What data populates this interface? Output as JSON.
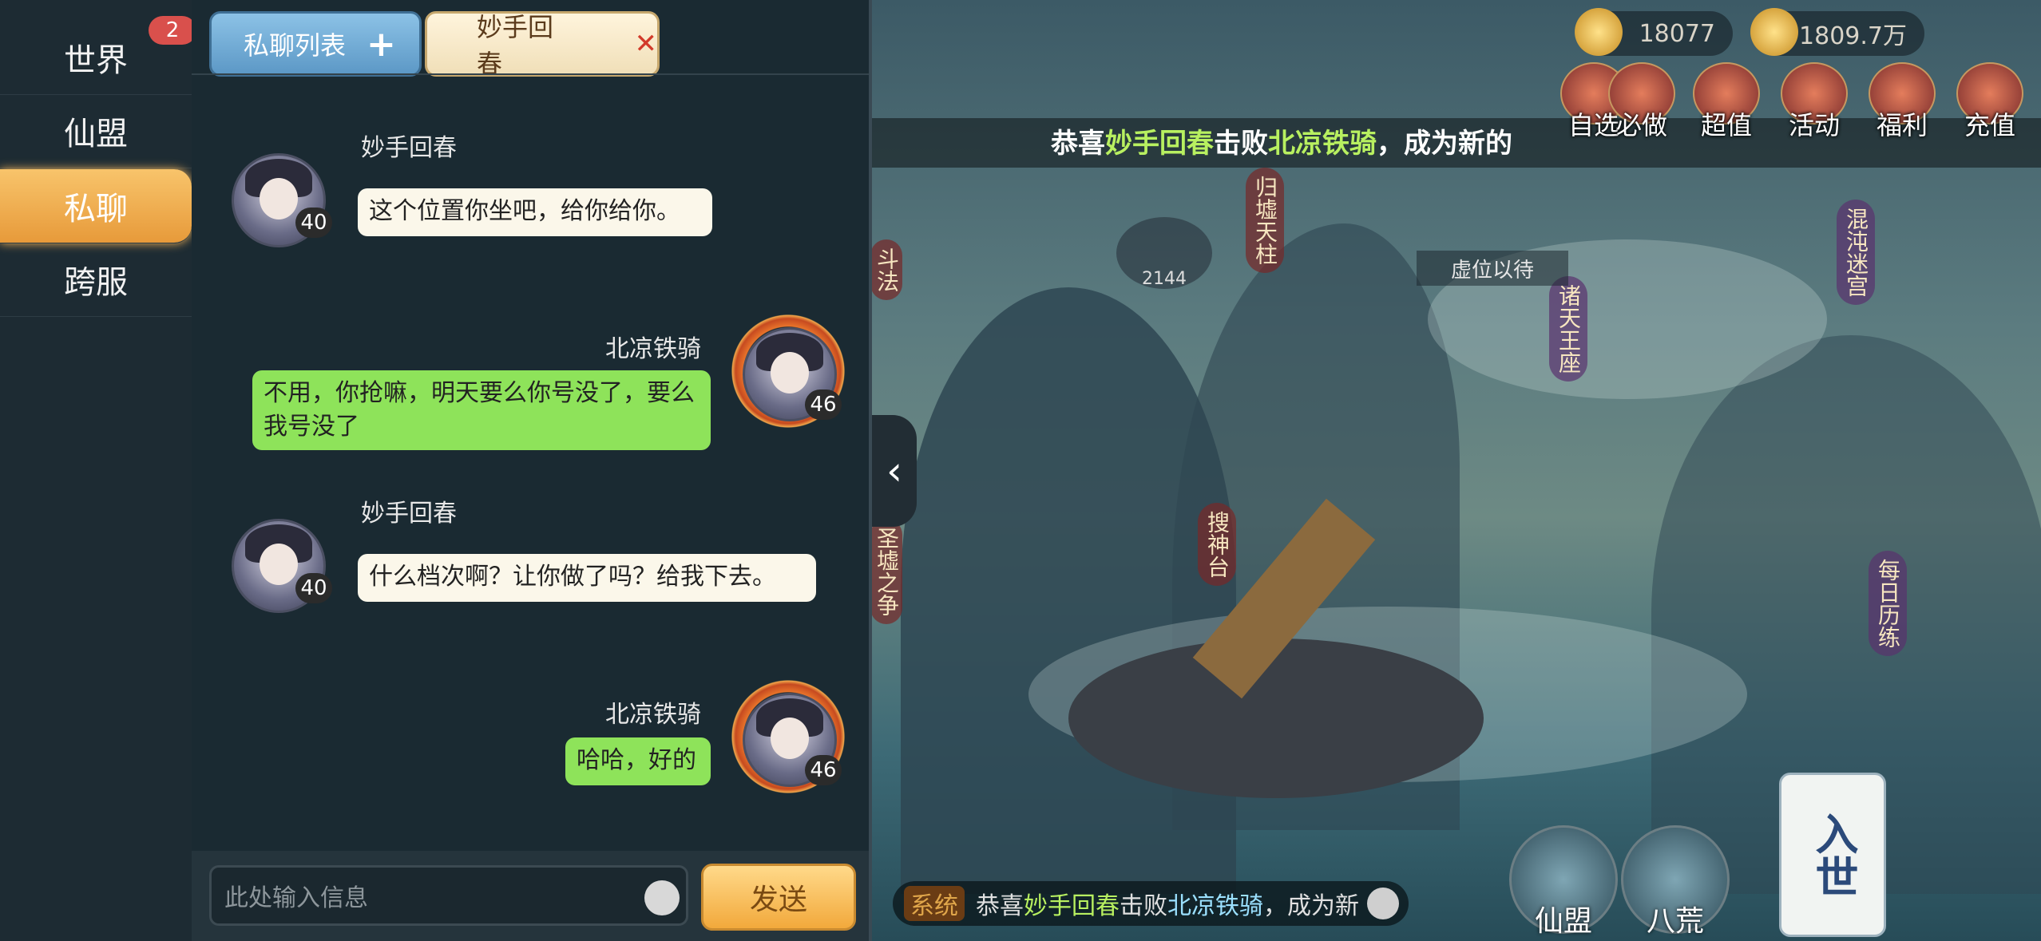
{
  "sidenav": {
    "items": [
      {
        "label": "世界"
      },
      {
        "label": "仙盟"
      },
      {
        "label": "私聊"
      },
      {
        "label": "跨服"
      }
    ],
    "world_badge": "2"
  },
  "tabs": {
    "list_label": "私聊列表",
    "list_add": "+",
    "active_label": "妙手回春",
    "active_close": "✕"
  },
  "messages": [
    {
      "sender": "妙手回春",
      "side": "left",
      "level": "40",
      "text": "这个位置你坐吧，给你给你。"
    },
    {
      "sender": "北凉铁骑",
      "side": "right",
      "level": "46",
      "text": "不用，你抢嘛，明天要么你号没了，要么我号没了"
    },
    {
      "sender": "妙手回春",
      "side": "left",
      "level": "40",
      "text": "什么档次啊？让你做了吗？给我下去。"
    },
    {
      "sender": "北凉铁骑",
      "side": "right",
      "level": "46",
      "text": "哈哈，好的"
    }
  ],
  "input": {
    "placeholder": "此处输入信息",
    "send_label": "发送"
  },
  "resources": {
    "currency1": "18077",
    "currency2": "1809.7万"
  },
  "top_icons": [
    "超值",
    "活动",
    "福利",
    "充值"
  ],
  "top_icons_partial": {
    "a": "自选",
    "b": "必做"
  },
  "marquee": {
    "prefix": "恭喜",
    "name1": "妙手回春",
    "mid": "击败",
    "name2": "北凉铁骑",
    "suffix": "，成为新的"
  },
  "scene_tags": {
    "guixu": "归墟天柱",
    "zhutian": "诸天王座",
    "hundun": "混沌迷宫",
    "soushen": "搜神台",
    "meiri": "每日历练",
    "doufa": "斗法",
    "shengxu": "圣墟之争",
    "placeholder": "虚位以待",
    "count": "2144"
  },
  "system_bar": {
    "tag": "系统",
    "prefix": "恭喜",
    "name1": "妙手回春",
    "mid": "击败",
    "name2": "北凉铁骑",
    "suffix": "，成为新"
  },
  "bottom_buttons": {
    "xianmeng": "仙盟",
    "bahuang": "八荒",
    "enter": "入世"
  },
  "colors": {
    "accent_orange": "#f2a93c",
    "bubble_green": "#8ee35a",
    "highlight_green": "#b8f060",
    "badge_red": "#d9504c"
  }
}
